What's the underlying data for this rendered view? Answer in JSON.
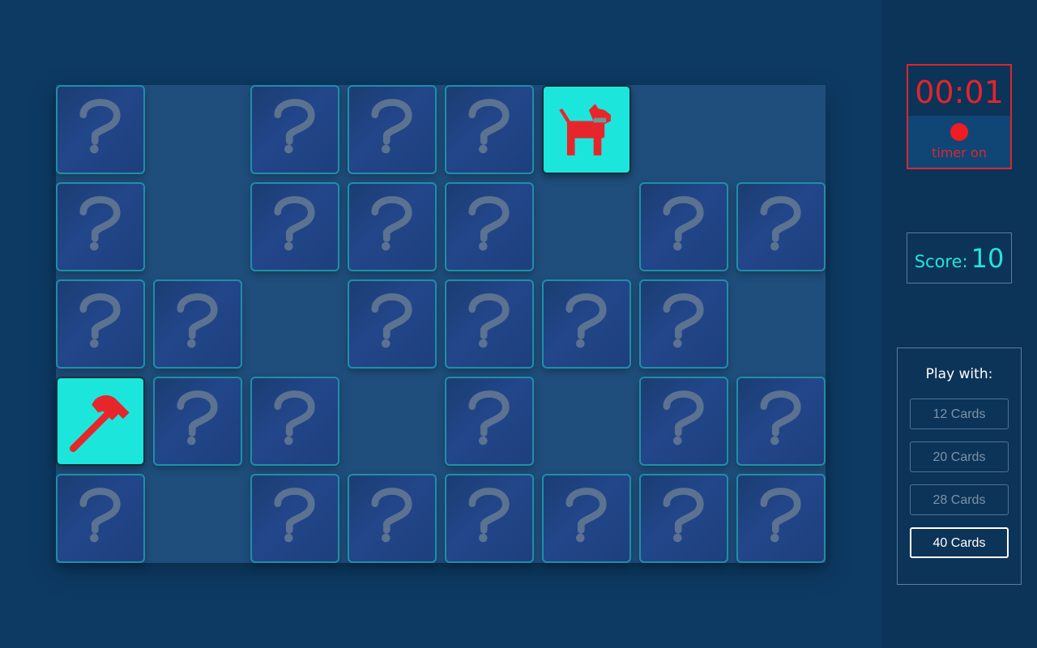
{
  "game": {
    "rows": 5,
    "cols": 8,
    "cards": [
      [
        "hidden",
        "matched",
        "hidden",
        "hidden",
        "hidden",
        "revealed:dog-icon",
        "matched",
        "matched"
      ],
      [
        "hidden",
        "matched",
        "hidden",
        "hidden",
        "hidden",
        "matched",
        "hidden",
        "hidden"
      ],
      [
        "hidden",
        "hidden",
        "matched",
        "hidden",
        "hidden",
        "hidden",
        "hidden",
        "matched"
      ],
      [
        "revealed:hammer-icon",
        "hidden",
        "hidden",
        "matched",
        "hidden",
        "matched",
        "hidden",
        "hidden"
      ],
      [
        "hidden",
        "matched",
        "hidden",
        "hidden",
        "hidden",
        "hidden",
        "hidden",
        "hidden"
      ]
    ],
    "card_back_icon": "question-mark-icon",
    "colors": {
      "revealed_bg": "#1ce6dc",
      "icon_red": "#e7262c",
      "board_bg": "#1f4e7c",
      "card_border": "#1e8fa8"
    }
  },
  "timer": {
    "time": "00:01",
    "status": "timer on",
    "color": "#e2242c"
  },
  "score": {
    "label": "Score:",
    "value": "10",
    "color": "#22e6d8"
  },
  "options": {
    "title": "Play with:",
    "buttons": [
      "12 Cards",
      "20 Cards",
      "28 Cards",
      "40 Cards"
    ],
    "selected": "40 Cards"
  }
}
